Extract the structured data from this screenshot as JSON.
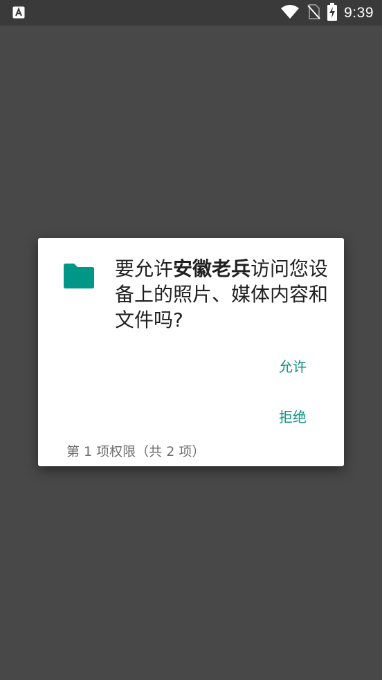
{
  "status_bar": {
    "time": "9:39",
    "left_icon": "app-notification-a-icon",
    "icons": [
      "wifi-icon",
      "no-sim-icon",
      "battery-charging-icon"
    ]
  },
  "dialog": {
    "icon": "folder-icon",
    "message_prefix": "要允许",
    "app_name": "安徽老兵",
    "message_suffix": "访问您设备上的照片、媒体内容和文件吗?",
    "allow_label": "允许",
    "deny_label": "拒绝",
    "page_count": "第 1 项权限（共 2 项）"
  },
  "colors": {
    "accent": "#0f8f7e",
    "icon": "#009688",
    "scrim": "#484848",
    "dialog_bg": "#ffffff"
  }
}
